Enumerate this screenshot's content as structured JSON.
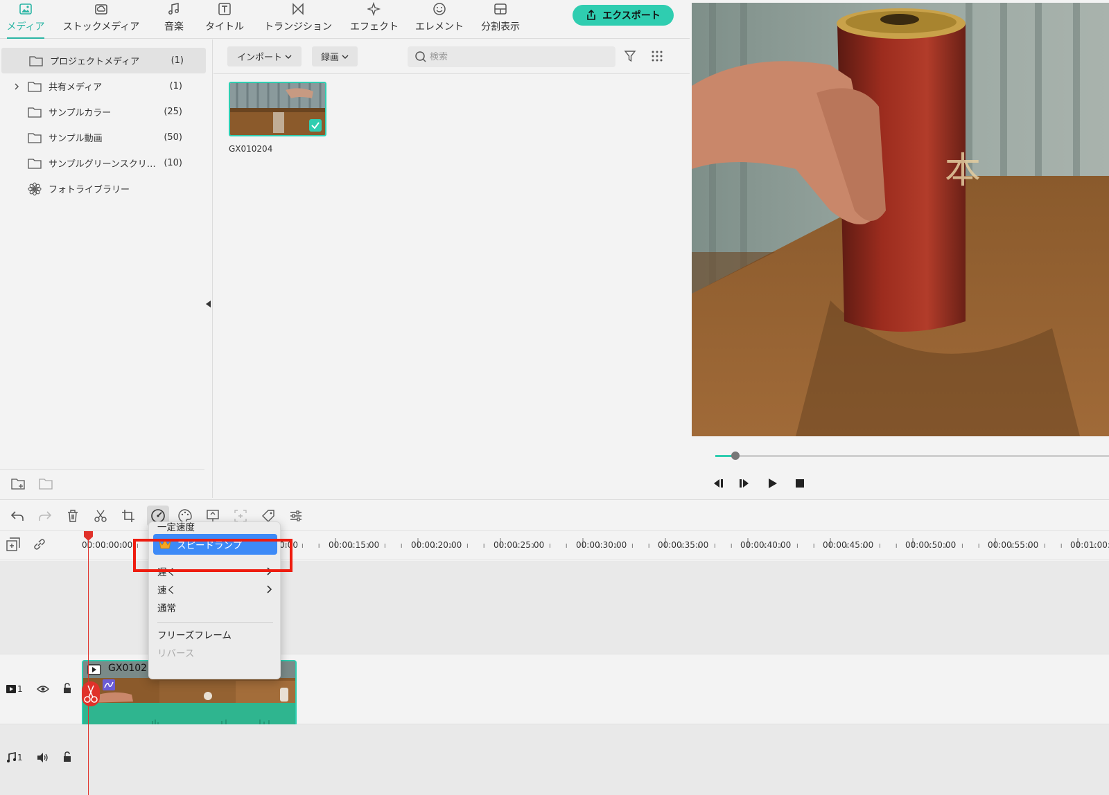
{
  "tabs": [
    {
      "label": "メディア",
      "icon": "image-icon",
      "active": true
    },
    {
      "label": "ストックメディア",
      "icon": "cloud-photo-icon"
    },
    {
      "label": "音楽",
      "icon": "music-note-icon"
    },
    {
      "label": "タイトル",
      "icon": "text-title-icon"
    },
    {
      "label": "トランジション",
      "icon": "transition-icon"
    },
    {
      "label": "エフェクト",
      "icon": "sparkle-icon"
    },
    {
      "label": "エレメント",
      "icon": "sticker-icon"
    },
    {
      "label": "分割表示",
      "icon": "split-screen-icon"
    }
  ],
  "export_label": "エクスポート",
  "accent_color": "#2fcdb0",
  "sidebar": {
    "items": [
      {
        "name": "プロジェクトメディア",
        "count": "(1)"
      },
      {
        "name": "共有メディア",
        "count": "(1)"
      },
      {
        "name": "サンプルカラー",
        "count": "(25)"
      },
      {
        "name": "サンプル動画",
        "count": "(50)"
      },
      {
        "name": "サンプルグリーンスクリ…",
        "count": "(10)"
      },
      {
        "name": "フォトライブラリー",
        "count": ""
      }
    ]
  },
  "media_toolbar": {
    "import_label": "インポート",
    "record_label": "録画",
    "search_placeholder": "検索"
  },
  "media_items": [
    {
      "name": "GX010204"
    }
  ],
  "preview": {
    "progress_fraction": 0.05
  },
  "timeline": {
    "tick_labels": [
      "00:00:00:00",
      "0:00",
      "00:00:15:00",
      "00:00:20:00",
      "00:00:25:00",
      "00:00:30:00",
      "00:00:35:00",
      "00:00:40:00",
      "00:00:45:00",
      "00:00:50:00",
      "00:00:55:00",
      "00:01:00:"
    ],
    "video_track_number": "1",
    "audio_track_number": "1",
    "clip_name": "GX0102"
  },
  "context_menu": {
    "header": "一定速度",
    "speed_ramp": "スピードランプ",
    "slow": "遅く",
    "fast": "速く",
    "normal": "通常",
    "freeze_frame": "フリーズフレーム",
    "reverse": "リバース"
  }
}
